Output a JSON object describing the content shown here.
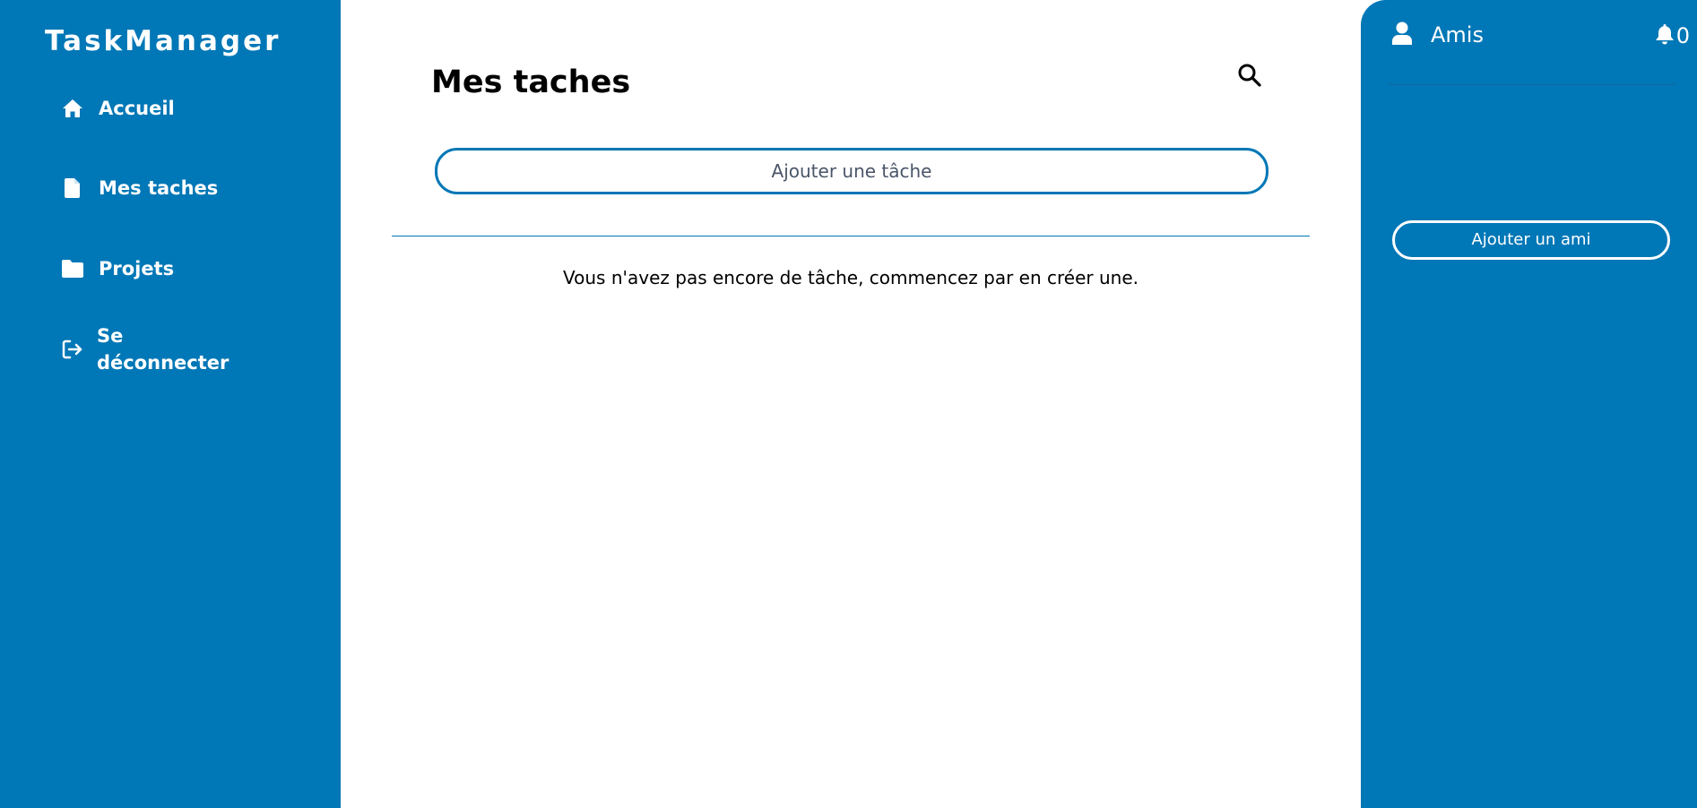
{
  "sidebar": {
    "brand": "TaskManager",
    "items": [
      {
        "label": "Accueil",
        "icon": "home-icon"
      },
      {
        "label": "Mes taches",
        "icon": "file-icon"
      },
      {
        "label": "Projets",
        "icon": "folder-icon"
      },
      {
        "label": "Se déconnecter",
        "icon": "logout-icon"
      }
    ]
  },
  "main": {
    "title": "Mes taches",
    "search_icon": "search-icon",
    "add_task_label": "Ajouter une tâche",
    "empty_message": "Vous n'avez pas encore de tâche, commencez par en créer une."
  },
  "right_panel": {
    "friends_label": "Amis",
    "friends_icon": "user-icon",
    "notification_icon": "bell-icon",
    "notification_count": "0",
    "add_friend_label": "Ajouter un ami"
  },
  "colors": {
    "brand_blue": "#0077b6",
    "text_dark": "#000000",
    "placeholder_gray": "#4a5568",
    "white": "#ffffff"
  }
}
